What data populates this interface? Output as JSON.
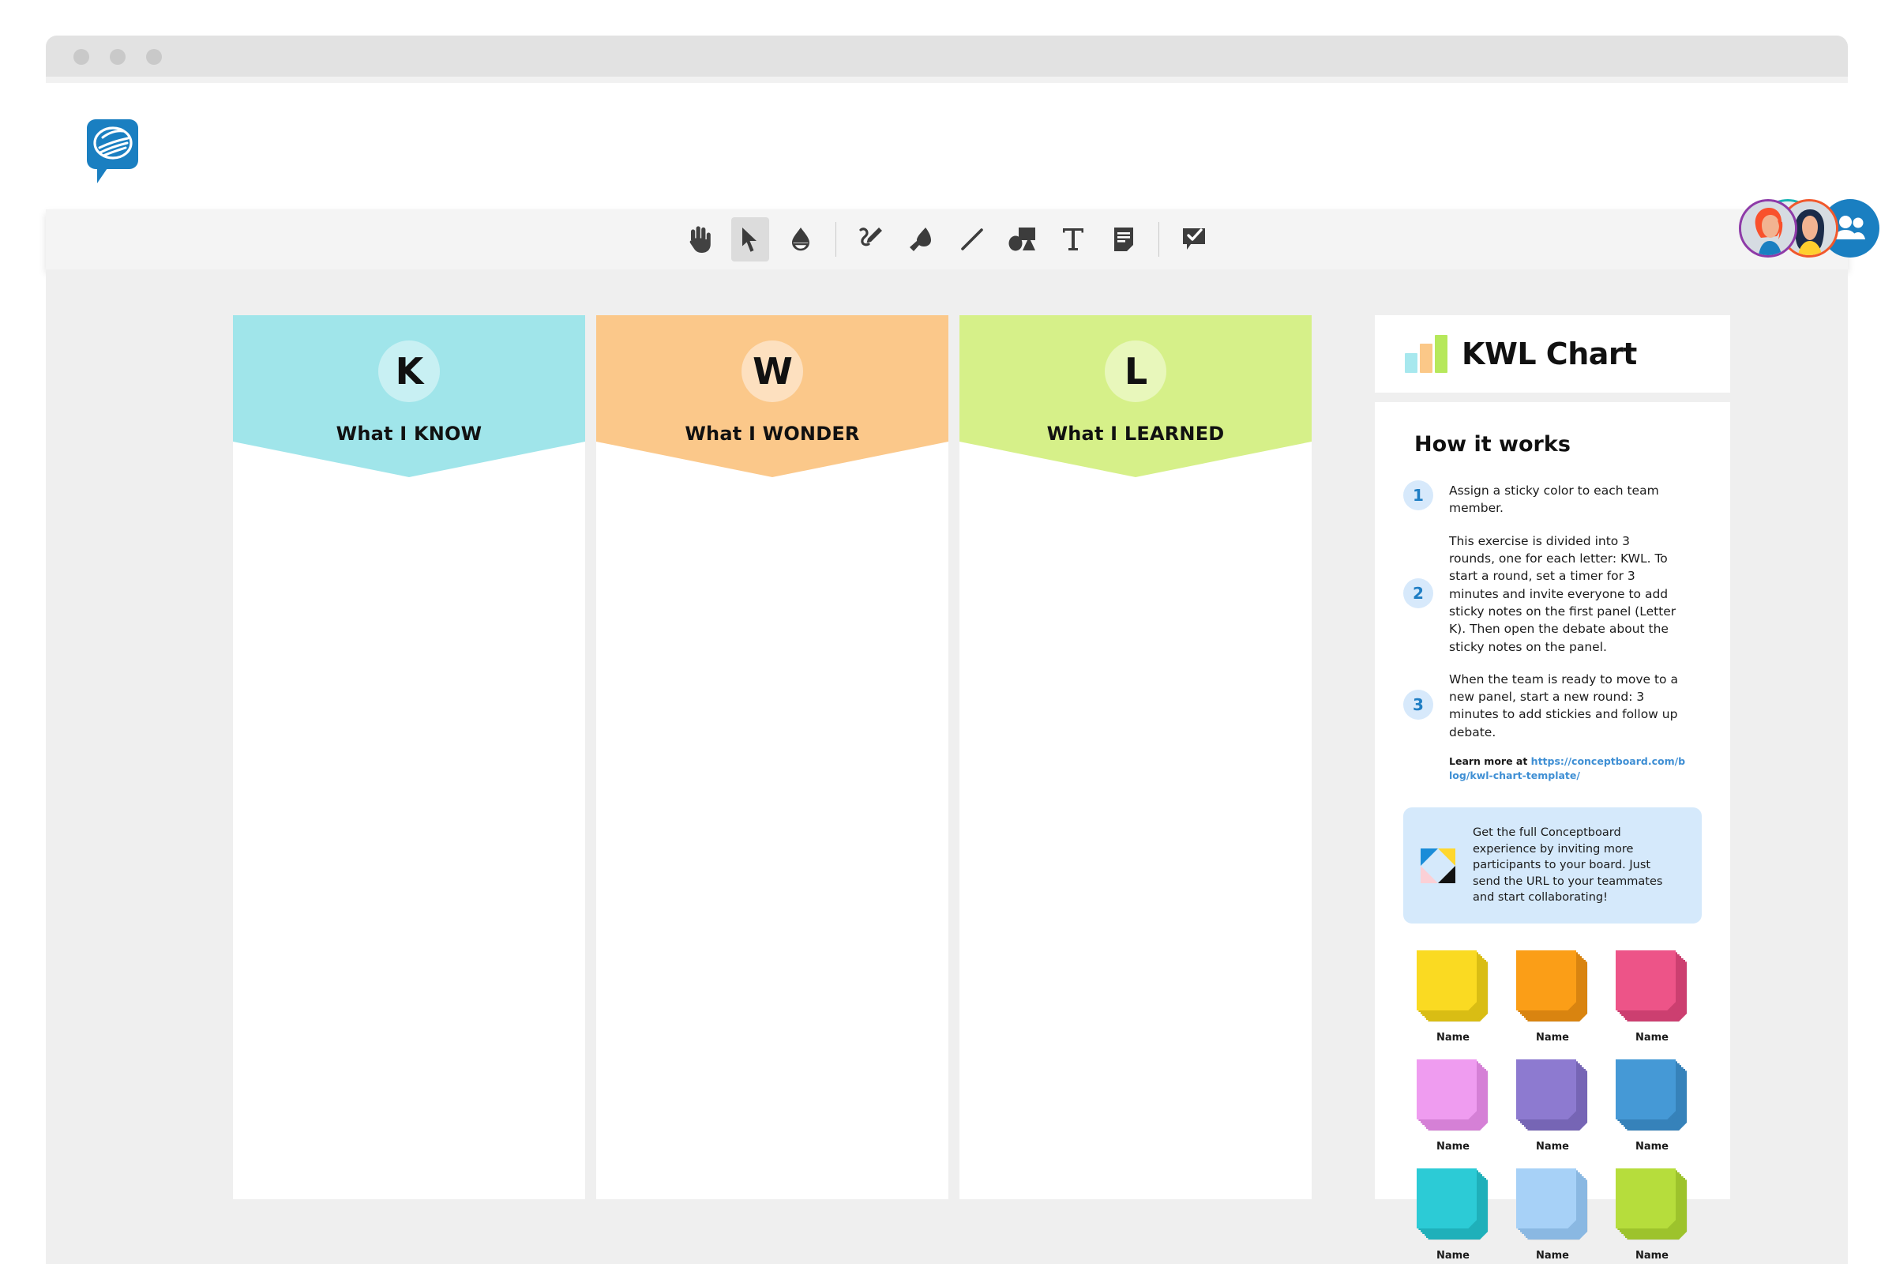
{
  "window": {
    "traffic_dots": [
      "close",
      "minimize",
      "maximize"
    ]
  },
  "header": {
    "logo_name": "conceptboard-logo",
    "placeholders": [
      "",
      "",
      ""
    ],
    "avatars": [
      {
        "name": "avatar-user-1",
        "ring": "#8e3ba8"
      },
      {
        "name": "avatar-user-2",
        "ring": "#f1582c"
      },
      {
        "name": "avatar-add-people",
        "ring": "#1a7fc1"
      }
    ],
    "avatar_self": {
      "name": "avatar-self",
      "ring": "#18b4b4"
    }
  },
  "toolbar": {
    "tools": [
      {
        "id": "hand",
        "label": "Hand",
        "icon": "hand-icon",
        "active": false
      },
      {
        "id": "select",
        "label": "Select",
        "icon": "cursor-icon",
        "active": true
      },
      {
        "id": "eraser",
        "label": "Eraser",
        "icon": "eraser-icon",
        "active": false
      },
      {
        "id": "pen",
        "label": "Pen",
        "icon": "pen-icon",
        "active": false
      },
      {
        "id": "marker",
        "label": "Marker",
        "icon": "marker-icon",
        "active": false
      },
      {
        "id": "line",
        "label": "Line",
        "icon": "line-icon",
        "active": false
      },
      {
        "id": "shapes",
        "label": "Shapes",
        "icon": "shapes-icon",
        "active": false
      },
      {
        "id": "text",
        "label": "Text",
        "icon": "text-icon",
        "active": false
      },
      {
        "id": "sticky",
        "label": "Sticky note",
        "icon": "sticky-note-icon",
        "active": false
      },
      {
        "id": "comment",
        "label": "Comment",
        "icon": "comment-check-icon",
        "active": false
      }
    ]
  },
  "board": {
    "columns": [
      {
        "letter": "K",
        "label": "What I KNOW",
        "banner_color": "#a0e5ea",
        "circle_color": "#c8f0f3"
      },
      {
        "letter": "W",
        "label": "What I WONDER",
        "banner_color": "#fbc88a",
        "circle_color": "#fde0bf"
      },
      {
        "letter": "L",
        "label": "What I LEARNED",
        "banner_color": "#d6f089",
        "circle_color": "#e8f7bb"
      }
    ]
  },
  "panel": {
    "title": "KWL Chart",
    "chart_icon_bars": [
      "#a7e8ee",
      "#fbc888",
      "#b6e85b"
    ],
    "how_it_works": "How it works",
    "steps": [
      {
        "num": "1",
        "text": "Assign a sticky color to each team member."
      },
      {
        "num": "2",
        "text": "This exercise is divided into 3 rounds, one for each letter: KWL. To start a round, set a timer for 3 minutes and invite everyone to add sticky notes on the first panel (Letter K). Then open the debate about the sticky notes on the panel."
      },
      {
        "num": "3",
        "text": "When the team is ready to move to a new panel, start a new round: 3 minutes to add stickies and follow up debate."
      }
    ],
    "learn_more_prefix": "Learn more at ",
    "learn_more_link": "https://conceptboard.com/blog/kwl-chart-template/",
    "promo_text": "Get the full Conceptboard experience by inviting more participants to your board. Just send the URL to your teammates and start collaborating!",
    "promo_icon": "conceptboard-diamond-icon",
    "swatches": [
      {
        "name": "Name",
        "color": "#fada22",
        "shade": "#d9bd14"
      },
      {
        "name": "Name",
        "color": "#fb9e17",
        "shade": "#d98410"
      },
      {
        "name": "Name",
        "color": "#ed5488",
        "shade": "#cc3f70"
      },
      {
        "name": "Name",
        "color": "#ef9cf0",
        "shade": "#d580d6"
      },
      {
        "name": "Name",
        "color": "#8d7ad0",
        "shade": "#7665b5"
      },
      {
        "name": "Name",
        "color": "#4599d6",
        "shade": "#3682ba"
      },
      {
        "name": "Name",
        "color": "#2ccbd6",
        "shade": "#1fb0ba"
      },
      {
        "name": "Name",
        "color": "#a7d1f7",
        "shade": "#8ab8e2"
      },
      {
        "name": "Name",
        "color": "#b6dd3c",
        "shade": "#9dc32c"
      }
    ]
  }
}
